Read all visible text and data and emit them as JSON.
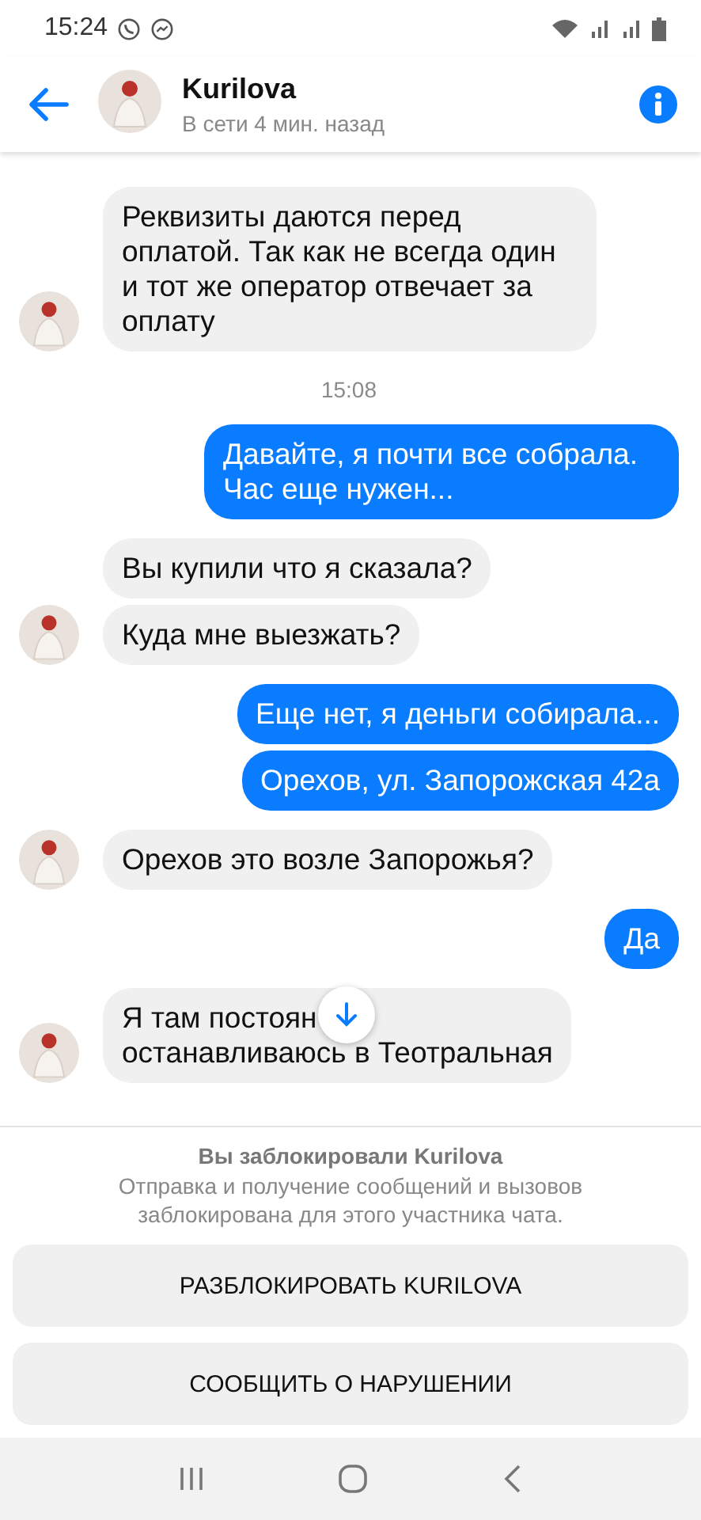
{
  "status_bar": {
    "time": "15:24"
  },
  "header": {
    "name": "Kurilova",
    "status": "В сети 4 мин. назад"
  },
  "messages": [
    {
      "kind": "in",
      "bubbles": [
        "Реквизиты даются перед оплатой. Так как не всегда один и тот же оператор отвечает за оплату"
      ]
    },
    {
      "kind": "time",
      "text": "15:08"
    },
    {
      "kind": "out",
      "bubbles": [
        "Давайте, я почти все собрала. Час еще нужен..."
      ]
    },
    {
      "kind": "in",
      "bubbles": [
        "Вы купили что я сказала?",
        "Куда мне выезжать?"
      ]
    },
    {
      "kind": "out",
      "bubbles": [
        "Еще нет, я деньги собирала...",
        "Орехов, ул. Запорожская 42а"
      ]
    },
    {
      "kind": "in",
      "bubbles": [
        "Орехов это возле Запорожья?"
      ]
    },
    {
      "kind": "out",
      "bubbles": [
        "Да"
      ]
    },
    {
      "kind": "in",
      "bubbles": [
        "Я там постоян\nостанавливаюсь в Теотральная"
      ]
    }
  ],
  "blocked": {
    "title": "Вы заблокировали Kurilova",
    "text": "Отправка и получение сообщений и вызовов заблокирована для этого участника чата.",
    "buttons": [
      "РАЗБЛОКИРОВАТЬ KURILOVA",
      "СООБЩИТЬ О НАРУШЕНИИ"
    ]
  }
}
